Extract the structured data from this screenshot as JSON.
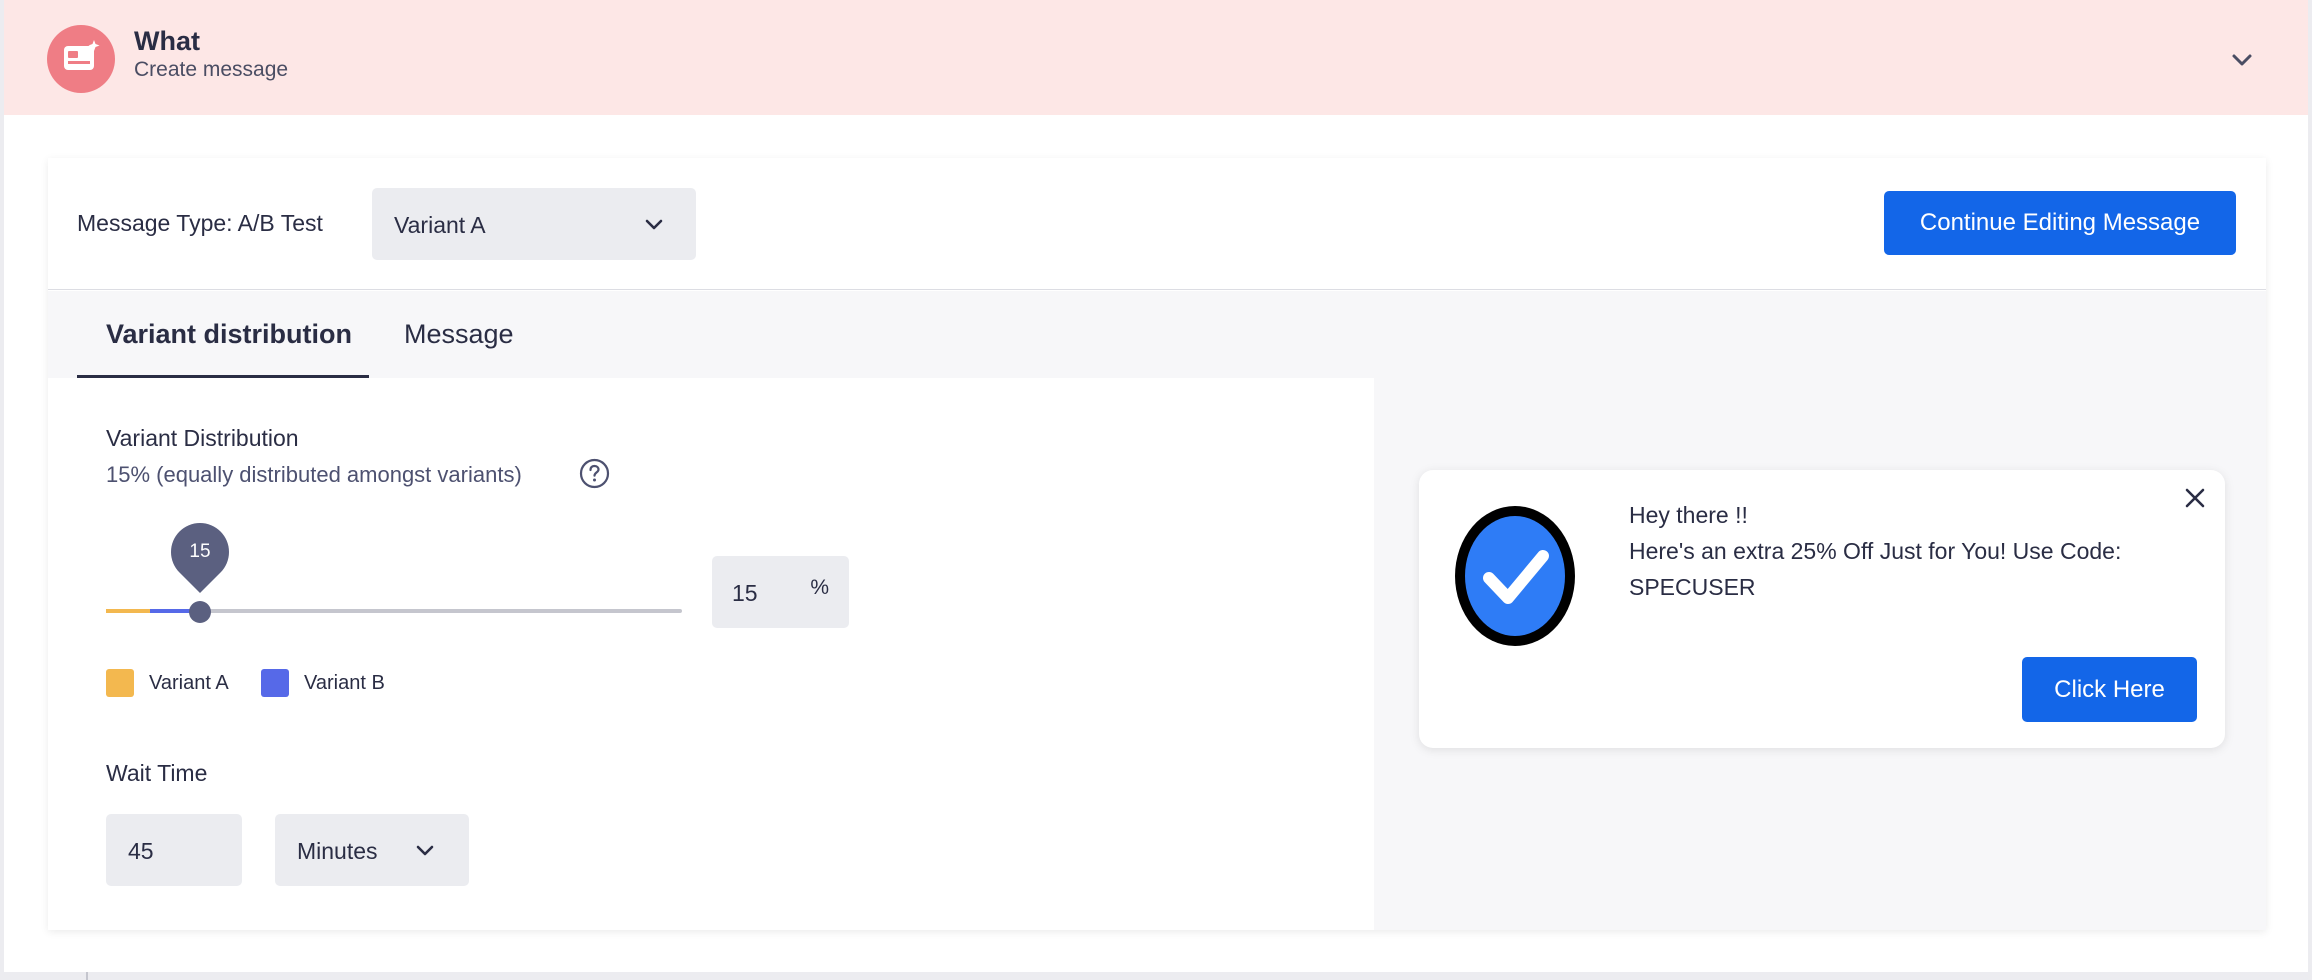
{
  "header": {
    "title": "What",
    "subtitle": "Create message",
    "icon": "message-image-icon",
    "accent": "#ef7d85",
    "background": "#fde7e6"
  },
  "toolbar": {
    "message_type_label": "Message Type: A/B Test",
    "variant_select_value": "Variant A",
    "continue_button": "Continue Editing Message",
    "button_color": "#1366e8"
  },
  "tabs": [
    {
      "label": "Variant distribution",
      "active": true
    },
    {
      "label": "Message",
      "active": false
    }
  ],
  "variant_distribution": {
    "title": "Variant Distribution",
    "subtitle": "15% (equally distributed amongst variants)",
    "slider_value": "15",
    "input_value": "15",
    "unit": "%",
    "legend": [
      {
        "label": "Variant A",
        "color": "#f3b84f"
      },
      {
        "label": "Variant B",
        "color": "#5669e8"
      }
    ]
  },
  "wait_time": {
    "title": "Wait Time",
    "value": "45",
    "unit": "Minutes"
  },
  "preview": {
    "line1": "Hey there !!",
    "line2": "Here's an extra 25% Off Just for You! Use Code:",
    "line3": "SPECUSER",
    "button": "Click Here",
    "image_icon": "checkmark-badge-icon"
  }
}
